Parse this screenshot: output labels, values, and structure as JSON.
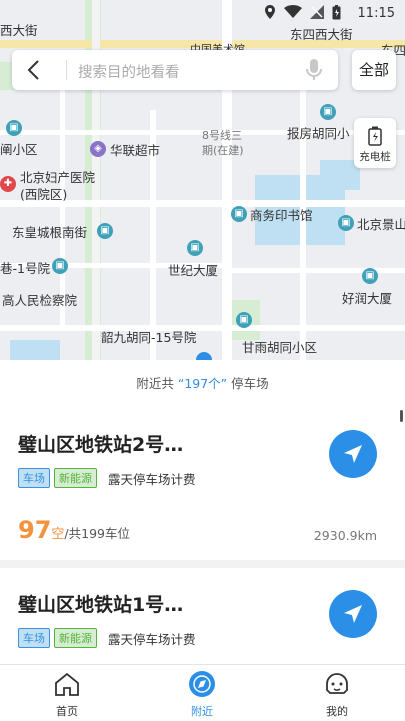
{
  "status_bar": {
    "time": "11:15"
  },
  "map": {
    "labels": {
      "l1": "西大街",
      "l2": "东四西大街",
      "l3": "东四",
      "l4": "中国美术馆",
      "l5": "阐小区",
      "l6": "华联超市",
      "l7": "8号线三",
      "l8": "期(在建)",
      "l9": "报房胡同小",
      "l10": "北京妇产医院",
      "l11": "(西院区)",
      "l12": "商务印书馆",
      "l13": "北京景山",
      "l14": "东皇城根南街",
      "l15": "巷-1号院",
      "l16": "世纪大厦",
      "l17": "高人民检察院",
      "l18": "好润大厦",
      "l19": "韶九胡同-15号院",
      "l20": "甘雨胡同小区"
    }
  },
  "search": {
    "placeholder": "搜索目的地看看"
  },
  "filter_button": "全部",
  "charging_button": "充电桩",
  "summary": {
    "prefix": "附近共",
    "count": "“197个”",
    "suffix": "停车场"
  },
  "parking_list": [
    {
      "name": "璧山区地铁站2号…",
      "tag1": "车场",
      "tag2": "新能源",
      "fee": "露天停车场计费",
      "available": "97",
      "available_unit": "空",
      "total": "/共199车位",
      "distance": "2930.9km"
    },
    {
      "name": "璧山区地铁站1号…",
      "tag1": "车场",
      "tag2": "新能源",
      "fee": "露天停车场计费"
    }
  ],
  "tabs": [
    {
      "label": "首页",
      "icon": "home-icon"
    },
    {
      "label": "附近",
      "icon": "compass-icon",
      "active": true
    },
    {
      "label": "我的",
      "icon": "profile-icon"
    }
  ],
  "colors": {
    "accent": "#2b8fe8",
    "available": "#f5923e",
    "tag_blue": "#3b8fe6",
    "tag_green": "#54b43b"
  }
}
